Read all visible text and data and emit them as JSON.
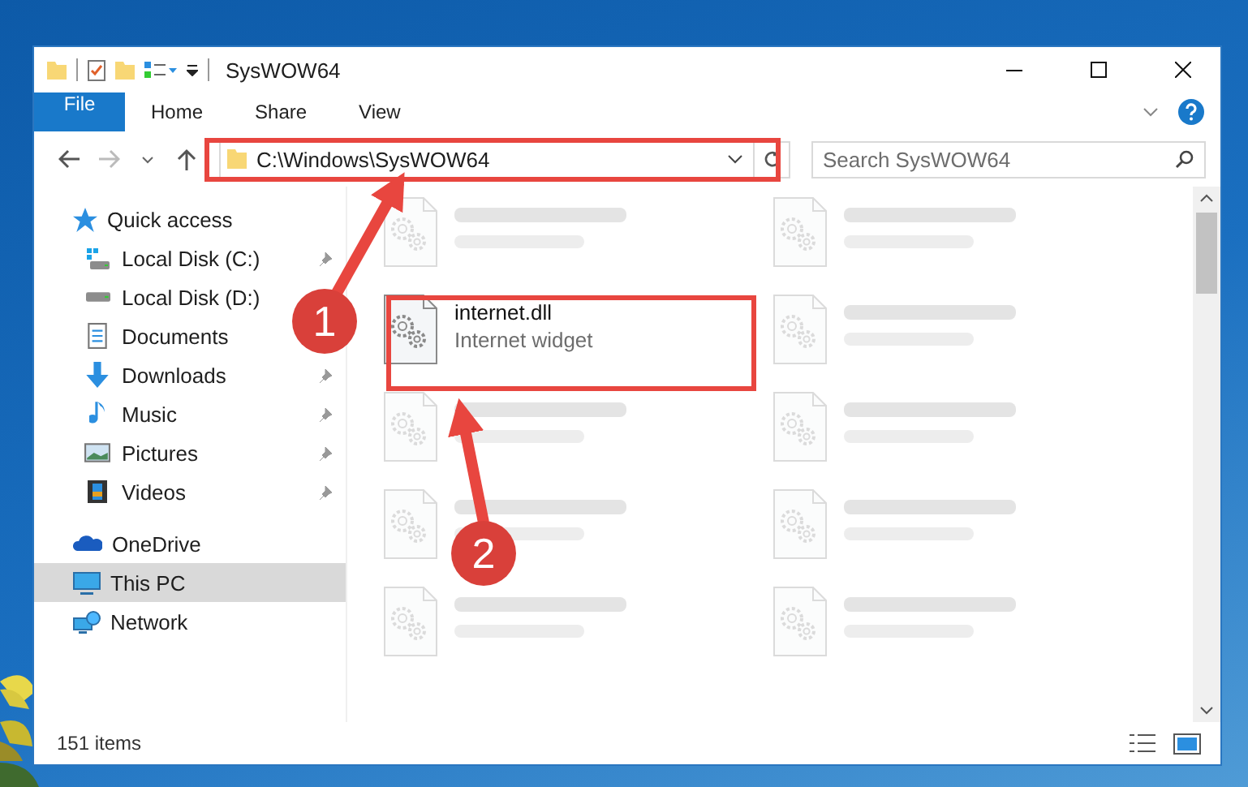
{
  "window": {
    "title": "SysWOW64"
  },
  "ribbon": {
    "tabs": [
      {
        "label": "File",
        "kind": "file"
      },
      {
        "label": "Home",
        "kind": "tab"
      },
      {
        "label": "Share",
        "kind": "tab"
      },
      {
        "label": "View",
        "kind": "tab"
      }
    ]
  },
  "address": {
    "path": "C:\\Windows\\SysWOW64"
  },
  "search": {
    "placeholder": "Search SysWOW64"
  },
  "sidebar": {
    "items": [
      {
        "label": "Quick access",
        "kind": "quick-access",
        "selected": false,
        "children": [
          {
            "label": "Local Disk (C:)",
            "kind": "system-drive",
            "pinned": true
          },
          {
            "label": "Local Disk (D:)",
            "kind": "drive"
          },
          {
            "label": "Documents",
            "kind": "documents"
          },
          {
            "label": "Downloads",
            "kind": "downloads",
            "pinned": true
          },
          {
            "label": "Music",
            "kind": "music",
            "pinned": true
          },
          {
            "label": "Pictures",
            "kind": "pictures",
            "pinned": true
          },
          {
            "label": "Videos",
            "kind": "videos",
            "pinned": true
          }
        ]
      },
      {
        "label": "OneDrive",
        "kind": "cloud",
        "selected": false
      },
      {
        "label": "This PC",
        "kind": "pc",
        "selected": true
      },
      {
        "label": "Network",
        "kind": "network",
        "selected": false
      }
    ]
  },
  "files": [
    {
      "blurred": true
    },
    {
      "blurred": true
    },
    {
      "name": "internet.dll",
      "type": "Internet widget",
      "blurred": false
    },
    {
      "blurred": true
    },
    {
      "blurred": true
    },
    {
      "blurred": true
    },
    {
      "blurred": true
    },
    {
      "blurred": true
    },
    {
      "blurred": true
    },
    {
      "blurred": true
    }
  ],
  "status_bar": {
    "item_count": "151 items"
  },
  "annotations": [
    {
      "number": "1"
    },
    {
      "number": "2"
    }
  ]
}
